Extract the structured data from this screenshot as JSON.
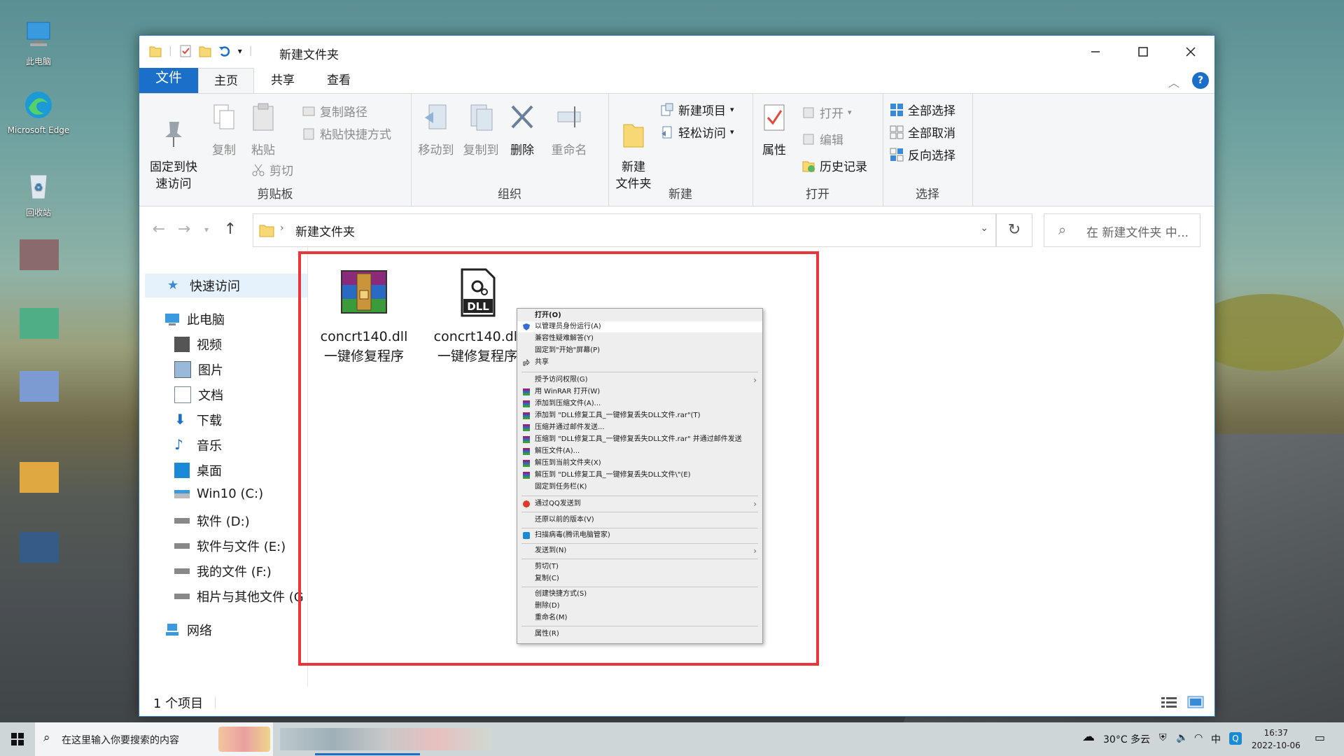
{
  "desktop": {
    "icons": [
      {
        "label": "此电脑"
      },
      {
        "label": "Microsoft Edge"
      },
      {
        "label": "回收站"
      }
    ]
  },
  "window": {
    "title": "新建文件夹",
    "tabs": [
      "文件",
      "主页",
      "共享",
      "查看"
    ],
    "help_icon": "?"
  },
  "ribbon": {
    "clipboard": {
      "pin_label": "固定到快\n速访问",
      "copy_label": "复制",
      "paste_label": "粘贴",
      "copy_path_label": "复制路径",
      "paste_shortcut_label": "粘贴快捷方式",
      "cut_label": "剪切",
      "group_label": "剪贴板"
    },
    "organize": {
      "move_label": "移动到",
      "copyto_label": "复制到",
      "delete_label": "删除",
      "rename_label": "重命名",
      "group_label": "组织"
    },
    "new": {
      "new_folder_label": "新建\n文件夹",
      "new_item_label": "新建项目",
      "easy_access_label": "轻松访问",
      "group_label": "新建"
    },
    "open": {
      "properties_label": "属性",
      "open_label": "打开",
      "edit_label": "编辑",
      "history_label": "历史记录",
      "group_label": "打开"
    },
    "select": {
      "select_all_label": "全部选择",
      "select_none_label": "全部取消",
      "invert_label": "反向选择",
      "group_label": "选择"
    }
  },
  "address": {
    "path": "新建文件夹",
    "search_placeholder": "在 新建文件夹 中..."
  },
  "nav": {
    "quick_access": "快速访问",
    "this_pc": "此电脑",
    "items": [
      "视频",
      "图片",
      "文档",
      "下载",
      "音乐",
      "桌面",
      "Win10 (C:)",
      "软件 (D:)",
      "软件与文件 (E:)",
      "我的文件 (F:)",
      "相片与其他文件 (G:"
    ],
    "network": "网络"
  },
  "files": [
    {
      "name": "concrt140.dll",
      "subtitle": "一键修复程序",
      "icon": "winrar-archive-icon"
    },
    {
      "name": "concrt140.dll",
      "subtitle": "一键修复程序",
      "icon": "dll-file-icon"
    }
  ],
  "status": {
    "count": "1 个项目"
  },
  "context_menu": {
    "items": [
      "打开(O)",
      "以管理员身份运行(A)",
      "兼容性疑难解答(Y)",
      "固定到\"开始\"屏幕(P)",
      "共享",
      "授予访问权限(G)",
      "用 WinRAR 打开(W)",
      "添加到压缩文件(A)...",
      "添加到 \"DLL修复工具_一键修复丢失DLL文件.rar\"(T)",
      "压缩并通过邮件发送...",
      "压缩到 \"DLL修复工具_一键修复丢失DLL文件.rar\" 并通过邮件发送",
      "解压文件(A)...",
      "解压到当前文件夹(X)",
      "解压到 \"DLL修复工具_一键修复丢失DLL文件\\\"(E)",
      "固定到任务栏(K)",
      "通过QQ发送到",
      "还原以前的版本(V)",
      "扫描病毒(腾讯电脑管家)",
      "发送到(N)",
      "剪切(T)",
      "复制(C)",
      "创建快捷方式(S)",
      "删除(D)",
      "重命名(M)",
      "属性(R)"
    ]
  },
  "taskbar": {
    "search_placeholder": "在这里输入你要搜索的内容",
    "weather": "30°C 多云",
    "time": "16:37",
    "date": "2022-10-06"
  },
  "colors": {
    "accent": "#1a6fc9",
    "highlight_box": "#e8363b",
    "nav_selected": "#e5f1fb"
  }
}
